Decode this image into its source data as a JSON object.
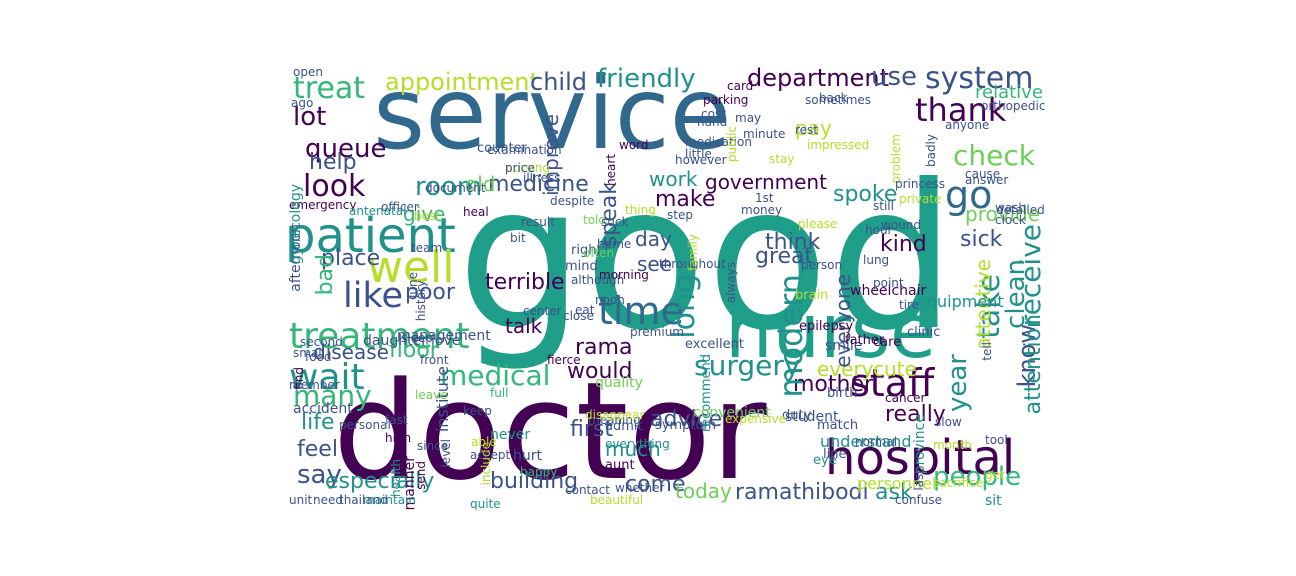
{
  "palette": {
    "dark_purple": "#440154",
    "indigo": "#3b528b",
    "blue": "#31688e",
    "teal": "#21918c",
    "teal_green": "#1f9e89",
    "green": "#35b779",
    "light_green": "#6ece58",
    "yellow_green": "#b5de2b",
    "yellow": "#d8e219"
  },
  "words": [
    {
      "text": "good",
      "color": "teal_green"
    },
    {
      "text": "doctor",
      "color": "dark_purple"
    },
    {
      "text": "service",
      "color": "blue"
    },
    {
      "text": "nurse",
      "color": "teal_green"
    },
    {
      "text": "hospital",
      "color": "dark_purple"
    },
    {
      "text": "patient",
      "color": "teal"
    },
    {
      "text": "time",
      "color": "blue"
    },
    {
      "text": "well",
      "color": "yellow_green"
    },
    {
      "text": "treatment",
      "color": "green"
    },
    {
      "text": "wait",
      "color": "teal"
    },
    {
      "text": "staff",
      "color": "dark_purple"
    },
    {
      "text": "treat",
      "color": "green"
    },
    {
      "text": "like",
      "color": "indigo"
    },
    {
      "text": "look",
      "color": "dark_purple"
    },
    {
      "text": "queue",
      "color": "dark_purple"
    },
    {
      "text": "lot",
      "color": "dark_purple"
    },
    {
      "text": "thank",
      "color": "dark_purple"
    },
    {
      "text": "go",
      "color": "blue"
    },
    {
      "text": "check",
      "color": "light_green"
    },
    {
      "text": "system",
      "color": "indigo"
    },
    {
      "text": "friendly",
      "color": "teal"
    },
    {
      "text": "appointment",
      "color": "yellow_green"
    },
    {
      "text": "child",
      "color": "indigo"
    },
    {
      "text": "department",
      "color": "dark_purple"
    },
    {
      "text": "use",
      "color": "indigo"
    },
    {
      "text": "room",
      "color": "teal"
    },
    {
      "text": "medicine",
      "color": "indigo"
    },
    {
      "text": "old",
      "color": "light_green"
    },
    {
      "text": "help",
      "color": "indigo"
    },
    {
      "text": "work",
      "color": "teal"
    },
    {
      "text": "government",
      "color": "dark_purple"
    },
    {
      "text": "make",
      "color": "dark_purple"
    },
    {
      "text": "spoke",
      "color": "teal"
    },
    {
      "text": "medical",
      "color": "green"
    },
    {
      "text": "surgery",
      "color": "teal"
    },
    {
      "text": "people",
      "color": "green"
    },
    {
      "text": "say",
      "color": "indigo"
    },
    {
      "text": "feel",
      "color": "indigo"
    },
    {
      "text": "life",
      "color": "teal"
    },
    {
      "text": "many",
      "color": "green"
    },
    {
      "text": "especially",
      "color": "teal"
    },
    {
      "text": "building",
      "color": "indigo"
    },
    {
      "text": "ramathibodi",
      "color": "indigo"
    },
    {
      "text": "ask",
      "color": "teal"
    },
    {
      "text": "come",
      "color": "indigo"
    },
    {
      "text": "today",
      "color": "light_green"
    },
    {
      "text": "first",
      "color": "indigo"
    },
    {
      "text": "much",
      "color": "teal"
    },
    {
      "text": "really",
      "color": "dark_purple"
    },
    {
      "text": "mother",
      "color": "dark_purple"
    },
    {
      "text": "every",
      "color": "yellow_green"
    },
    {
      "text": "cute",
      "color": "yellow_green"
    },
    {
      "text": "modern",
      "color": "teal"
    },
    {
      "text": "take",
      "color": "teal"
    },
    {
      "text": "clean",
      "color": "teal"
    },
    {
      "text": "year",
      "color": "teal"
    },
    {
      "text": "receive",
      "color": "teal"
    },
    {
      "text": "know",
      "color": "indigo"
    },
    {
      "text": "attentive",
      "color": "yellow_green"
    },
    {
      "text": "attention",
      "color": "teal"
    },
    {
      "text": "sick",
      "color": "indigo"
    },
    {
      "text": "kind",
      "color": "dark_purple"
    },
    {
      "text": "think",
      "color": "indigo"
    },
    {
      "text": "great",
      "color": "indigo"
    },
    {
      "text": "everyone",
      "color": "indigo"
    },
    {
      "text": "see",
      "color": "indigo"
    },
    {
      "text": "day",
      "color": "indigo"
    },
    {
      "text": "long",
      "color": "teal"
    },
    {
      "text": "terrible",
      "color": "dark_purple"
    },
    {
      "text": "poor",
      "color": "indigo"
    },
    {
      "text": "place",
      "color": "indigo"
    },
    {
      "text": "bad",
      "color": "green"
    },
    {
      "text": "talk",
      "color": "dark_purple"
    },
    {
      "text": "disease",
      "color": "indigo"
    },
    {
      "text": "floor",
      "color": "green"
    },
    {
      "text": "rama",
      "color": "dark_purple"
    },
    {
      "text": "would",
      "color": "dark_purple"
    },
    {
      "text": "advice",
      "color": "indigo"
    },
    {
      "text": "improve",
      "color": "indigo"
    },
    {
      "text": "speak",
      "color": "indigo"
    },
    {
      "text": "give",
      "color": "green"
    },
    {
      "text": "pay",
      "color": "yellow_green"
    },
    {
      "text": "provide",
      "color": "light_green"
    },
    {
      "text": "relative",
      "color": "green"
    },
    {
      "text": "equipment",
      "color": "teal"
    },
    {
      "text": "personnel",
      "color": "yellow_green"
    },
    {
      "text": "understand",
      "color": "teal"
    },
    {
      "text": "province",
      "color": "teal"
    },
    {
      "text": "manner",
      "color": "dark_purple"
    },
    {
      "text": "institute",
      "color": "indigo"
    },
    {
      "text": "management",
      "color": "indigo"
    },
    {
      "text": "daughter",
      "color": "indigo"
    },
    {
      "text": "emergency",
      "color": "dark_purple"
    },
    {
      "text": "afternoon",
      "color": "indigo"
    },
    {
      "text": "gynecology",
      "color": "teal"
    },
    {
      "text": "maintain",
      "color": "teal"
    },
    {
      "text": "thailand",
      "color": "indigo"
    },
    {
      "text": "unit",
      "color": "indigo"
    },
    {
      "text": "quite",
      "color": "teal"
    },
    {
      "text": "beautiful",
      "color": "yellow_green"
    },
    {
      "text": "whether",
      "color": "indigo"
    },
    {
      "text": "contact",
      "color": "indigo"
    },
    {
      "text": "hurt",
      "color": "indigo"
    },
    {
      "text": "aunt",
      "color": "dark_purple"
    },
    {
      "text": "everything",
      "color": "teal"
    },
    {
      "text": "admit",
      "color": "indigo"
    },
    {
      "text": "symptom",
      "color": "indigo"
    },
    {
      "text": "premium",
      "color": "indigo"
    },
    {
      "text": "excellent",
      "color": "indigo"
    },
    {
      "text": "quality",
      "color": "light_green"
    },
    {
      "text": "recommend",
      "color": "teal"
    },
    {
      "text": "convenient",
      "color": "light_green"
    },
    {
      "text": "student",
      "color": "indigo"
    },
    {
      "text": "birth",
      "color": "indigo"
    },
    {
      "text": "match",
      "color": "indigo"
    },
    {
      "text": "line",
      "color": "indigo"
    },
    {
      "text": "eye",
      "color": "teal"
    },
    {
      "text": "duty",
      "color": "indigo"
    },
    {
      "text": "smile",
      "color": "indigo"
    },
    {
      "text": "father",
      "color": "dark_purple"
    },
    {
      "text": "care",
      "color": "dark_purple"
    },
    {
      "text": "clinic",
      "color": "indigo"
    },
    {
      "text": "epilepsy",
      "color": "dark_purple"
    },
    {
      "text": "brain",
      "color": "yellow_green"
    },
    {
      "text": "wheelchair",
      "color": "dark_purple"
    },
    {
      "text": "always",
      "color": "indigo"
    },
    {
      "text": "right",
      "color": "indigo"
    },
    {
      "text": "mind",
      "color": "indigo"
    },
    {
      "text": "close",
      "color": "indigo"
    },
    {
      "text": "center",
      "color": "indigo"
    },
    {
      "text": "fierce",
      "color": "dark_purple"
    },
    {
      "text": "love",
      "color": "indigo"
    },
    {
      "text": "since",
      "color": "indigo"
    },
    {
      "text": "level",
      "color": "indigo"
    },
    {
      "text": "front",
      "color": "indigo"
    },
    {
      "text": "high",
      "color": "dark_purple"
    },
    {
      "text": "fast",
      "color": "indigo"
    },
    {
      "text": "never",
      "color": "teal"
    },
    {
      "text": "keep",
      "color": "indigo"
    },
    {
      "text": "able",
      "color": "yellow_green"
    },
    {
      "text": "full",
      "color": "green"
    },
    {
      "text": "happy",
      "color": "green"
    },
    {
      "text": "accept",
      "color": "indigo"
    },
    {
      "text": "include",
      "color": "yellow_green"
    },
    {
      "text": "send",
      "color": "dark_purple"
    },
    {
      "text": "health",
      "color": "teal"
    },
    {
      "text": "personal",
      "color": "indigo"
    },
    {
      "text": "accident",
      "color": "indigo"
    },
    {
      "text": "need",
      "color": "indigo"
    },
    {
      "text": "find",
      "color": "dark_purple"
    },
    {
      "text": "member",
      "color": "indigo"
    },
    {
      "text": "small",
      "color": "indigo"
    },
    {
      "text": "second",
      "color": "indigo"
    },
    {
      "text": "food",
      "color": "indigo"
    },
    {
      "text": "sleep",
      "color": "indigo"
    },
    {
      "text": "best",
      "color": "yellow_green"
    },
    {
      "text": "team",
      "color": "indigo"
    },
    {
      "text": "officer",
      "color": "indigo"
    },
    {
      "text": "antenatal",
      "color": "teal"
    },
    {
      "text": "ago",
      "color": "indigo"
    },
    {
      "text": "open",
      "color": "indigo"
    },
    {
      "text": "heal",
      "color": "dark_purple"
    },
    {
      "text": "document",
      "color": "indigo"
    },
    {
      "text": "counter",
      "color": "indigo"
    },
    {
      "text": "examination",
      "color": "indigo"
    },
    {
      "text": "nursing",
      "color": "yellow_green"
    },
    {
      "text": "price",
      "color": "indigo"
    },
    {
      "text": "despite",
      "color": "indigo"
    },
    {
      "text": "illness",
      "color": "indigo"
    },
    {
      "text": "heart",
      "color": "dark_purple"
    },
    {
      "text": "morning",
      "color": "dark_purple"
    },
    {
      "text": "word",
      "color": "dark_purple"
    },
    {
      "text": "little",
      "color": "indigo"
    },
    {
      "text": "however",
      "color": "indigo"
    },
    {
      "text": "medication",
      "color": "indigo"
    },
    {
      "text": "hand",
      "color": "indigo"
    },
    {
      "text": "cost",
      "color": "indigo"
    },
    {
      "text": "card",
      "color": "dark_purple"
    },
    {
      "text": "may",
      "color": "indigo"
    },
    {
      "text": "minute",
      "color": "indigo"
    },
    {
      "text": "public",
      "color": "yellow_green"
    },
    {
      "text": "rest",
      "color": "indigo"
    },
    {
      "text": "stay",
      "color": "yellow_green"
    },
    {
      "text": "sometimes",
      "color": "indigo"
    },
    {
      "text": "back",
      "color": "indigo"
    },
    {
      "text": "impressed",
      "color": "yellow_green"
    },
    {
      "text": "problem",
      "color": "yellow_green"
    },
    {
      "text": "cause",
      "color": "indigo"
    },
    {
      "text": "still",
      "color": "indigo"
    },
    {
      "text": "hour",
      "color": "indigo"
    },
    {
      "text": "princess",
      "color": "indigo"
    },
    {
      "text": "private",
      "color": "yellow_green"
    },
    {
      "text": "detailed",
      "color": "indigo"
    },
    {
      "text": "answer",
      "color": "indigo"
    },
    {
      "text": "anyone",
      "color": "indigo"
    },
    {
      "text": "orthopedic",
      "color": "indigo"
    },
    {
      "text": "parking",
      "color": "dark_purple"
    },
    {
      "text": "result",
      "color": "indigo"
    },
    {
      "text": "bit",
      "color": "indigo"
    },
    {
      "text": "hpme",
      "color": "indigo"
    },
    {
      "text": "often",
      "color": "light_green"
    },
    {
      "text": "told",
      "color": "light_green"
    },
    {
      "text": "history",
      "color": "indigo"
    },
    {
      "text": "leave",
      "color": "light_green"
    },
    {
      "text": "june",
      "color": "indigo"
    },
    {
      "text": "although",
      "color": "indigo"
    },
    {
      "text": "throughout",
      "color": "indigo"
    },
    {
      "text": "family",
      "color": "yellow_green"
    },
    {
      "text": "noon",
      "color": "indigo"
    },
    {
      "text": "thing",
      "color": "yellow_green"
    },
    {
      "text": "suck",
      "color": "indigo"
    },
    {
      "text": "step",
      "color": "indigo"
    },
    {
      "text": "1st",
      "color": "indigo"
    },
    {
      "text": "person",
      "color": "indigo"
    },
    {
      "text": "please",
      "color": "yellow_green"
    },
    {
      "text": "lung",
      "color": "indigo"
    },
    {
      "text": "point",
      "color": "indigo"
    },
    {
      "text": "tire",
      "color": "indigo"
    },
    {
      "text": "slow",
      "color": "indigo"
    },
    {
      "text": "cancer",
      "color": "dark_purple"
    },
    {
      "text": "month",
      "color": "yellow_green"
    },
    {
      "text": "tool",
      "color": "indigo"
    },
    {
      "text": "sacrifice",
      "color": "yellow_green"
    },
    {
      "text": "sit",
      "color": "teal"
    },
    {
      "text": "get",
      "color": "yellow_green"
    },
    {
      "text": "confuse",
      "color": "indigo"
    },
    {
      "text": "clock",
      "color": "indigo"
    },
    {
      "text": "wash",
      "color": "indigo"
    },
    {
      "text": "money",
      "color": "indigo"
    },
    {
      "text": "last",
      "color": "indigo"
    },
    {
      "text": "badly",
      "color": "indigo"
    },
    {
      "text": "eat",
      "color": "indigo"
    },
    {
      "text": "meaning",
      "color": "indigo"
    },
    {
      "text": "disappear",
      "color": "yellow_green"
    },
    {
      "text": "expensive",
      "color": "yellow_green"
    },
    {
      "text": "wound",
      "color": "indigo"
    },
    {
      "text": "tell",
      "color": "indigo"
    },
    {
      "text": "normal",
      "color": "indigo"
    }
  ]
}
